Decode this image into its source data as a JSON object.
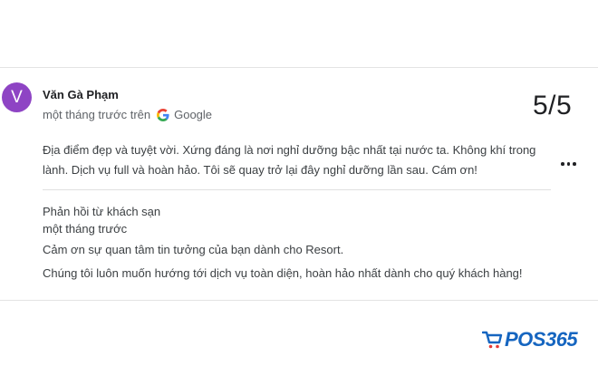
{
  "review": {
    "avatar_letter": "V",
    "avatar_color": "#8e44c4",
    "reviewer_name": "Văn Gà Phạm",
    "time_source": "một tháng trước trên",
    "source_name": "Google",
    "source_icon": "google-g-icon",
    "score": "5/5",
    "text": "Địa điểm đẹp và tuyệt vời. Xứng đáng là nơi nghỉ dưỡng bậc nhất tại nước ta. Không khí trong lành. Dịch vụ full và hoàn hảo. Tôi sẽ quay trở lại đây nghỉ dưỡng lần sau. Cám ơn!",
    "more_icon": "more-horizontal-icon"
  },
  "reply": {
    "label": "Phản hồi từ khách sạn",
    "time": "một tháng trước",
    "line1": "Cảm ơn sự quan tâm tin tưởng của bạn dành cho Resort.",
    "line2": "Chúng tôi luôn muốn hướng tới dịch vụ toàn diện, hoàn hảo nhất dành cho quý khách hàng!"
  },
  "watermark": {
    "text": "POS365",
    "icon": "shopping-cart-icon",
    "color": "#1565c0"
  }
}
